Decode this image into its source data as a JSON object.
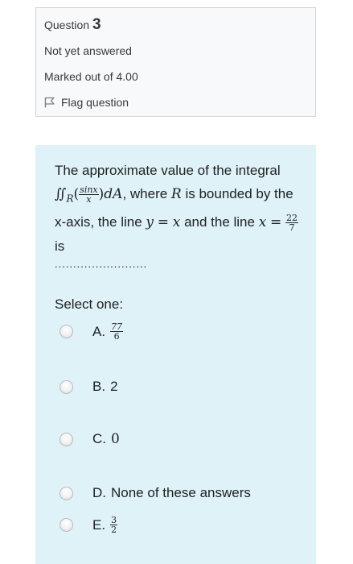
{
  "info": {
    "question_label": "Question",
    "question_number": "3",
    "state": "Not yet answered",
    "grade": "Marked out of 4.00",
    "flag_label": "Flag question",
    "flag_icon": "flag-icon"
  },
  "question": {
    "text_1": "The approximate value of the integral",
    "integral_symbol": "∬",
    "region": "R",
    "frac_num": "sinx",
    "frac_den": "x",
    "dA": "dA",
    "text_2": ", where",
    "R": "R",
    "text_3": "is bounded by the x-axis, the line",
    "y": "y",
    "eq": "=",
    "x1": "x",
    "text_4": "and the line",
    "x2": "x",
    "eq2": "=",
    "f22": "22",
    "f7": "7",
    "text_5": "is",
    "blank": "........................."
  },
  "answer": {
    "prompt": "Select one:",
    "options": [
      {
        "letter": "A.",
        "num": "77",
        "den": "6"
      },
      {
        "letter": "B.",
        "text": "2"
      },
      {
        "letter": "C.",
        "text": "0"
      },
      {
        "letter": "D.",
        "text": "None of these answers"
      },
      {
        "letter": "E.",
        "num": "3",
        "den": "2"
      }
    ]
  },
  "colors": {
    "info_bg": "#f8f9fa",
    "info_border": "#cfd4d8",
    "formulation_bg": "#def2f8",
    "text": "#222222"
  }
}
